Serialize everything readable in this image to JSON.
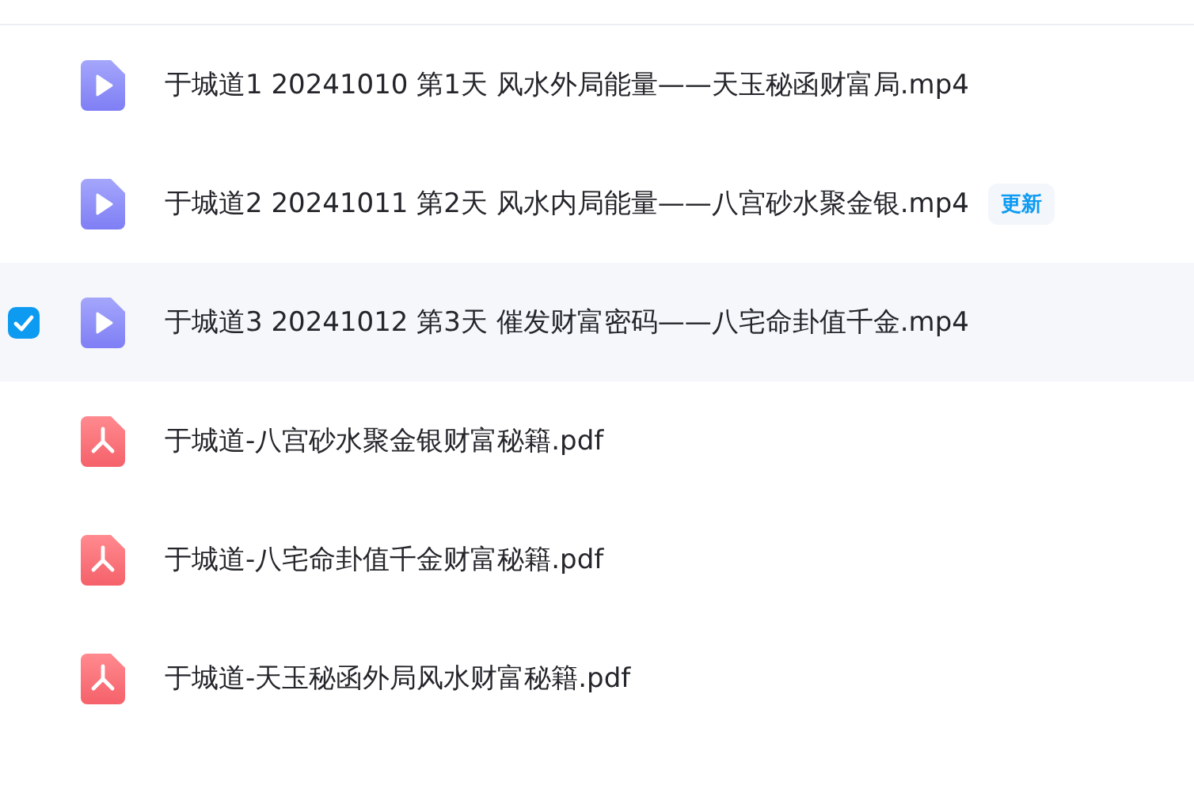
{
  "files": [
    {
      "kind": "video",
      "name": "于城道1 20241010 第1天 风水外局能量——天玉秘函财富局.mp4",
      "selected": false
    },
    {
      "kind": "video",
      "name": "于城道2 20241011 第2天 风水内局能量——八宫砂水聚金银.mp4",
      "selected": false,
      "badge": "更新"
    },
    {
      "kind": "video",
      "name": "于城道3 20241012 第3天 催发财富密码——八宅命卦值千金.mp4",
      "selected": true
    },
    {
      "kind": "pdf",
      "name": "于城道-八宫砂水聚金银财富秘籍.pdf",
      "selected": false
    },
    {
      "kind": "pdf",
      "name": "于城道-八宅命卦值千金财富秘籍.pdf",
      "selected": false
    },
    {
      "kind": "pdf",
      "name": "于城道-天玉秘函外局风水财富秘籍.pdf",
      "selected": false
    }
  ]
}
